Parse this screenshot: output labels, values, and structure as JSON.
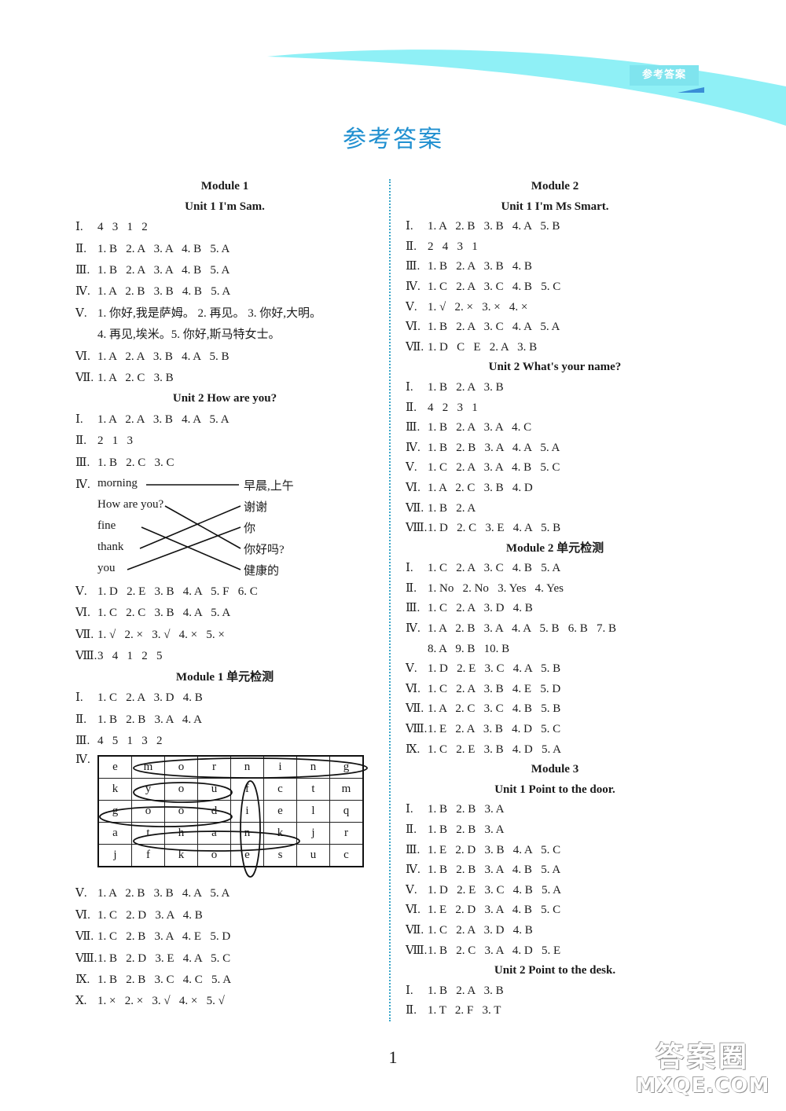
{
  "header": {
    "badge_label": "参考答案",
    "title": "参考答案",
    "brand_color": "#1f8fd0",
    "swoosh_color": "#8ff0f6"
  },
  "left_column": {
    "m1_title": "Module 1",
    "m1u1_title": "Unit 1   I'm Sam.",
    "m1u1": [
      {
        "n": "Ⅰ.",
        "a": "4   3   1   2"
      },
      {
        "n": "Ⅱ.",
        "a": "1. B   2. A   3. A   4. B   5. A"
      },
      {
        "n": "Ⅲ.",
        "a": "1. B   2. A   3. A   4. B   5. A"
      },
      {
        "n": "Ⅳ.",
        "a": "1. A   2. B   3. B   4. B   5. A"
      },
      {
        "n": "Ⅴ.",
        "a": "1. 你好,我是萨姆。 2. 再见。 3. 你好,大明。"
      },
      {
        "n": "",
        "a": "4. 再见,埃米。5. 你好,斯马特女士。"
      },
      {
        "n": "Ⅵ.",
        "a": "1. A   2. A   3. B   4. A   5. B"
      },
      {
        "n": "Ⅶ.",
        "a": "1. A   2. C   3. B"
      }
    ],
    "m1u2_title": "Unit 2   How are you?",
    "m1u2_top": [
      {
        "n": "Ⅰ.",
        "a": "1. A   2. A   3. B   4. A   5. A"
      },
      {
        "n": "Ⅱ.",
        "a": "2   1   3"
      },
      {
        "n": "Ⅲ.",
        "a": "1. B   2. C   3. C"
      }
    ],
    "matching": {
      "label": "Ⅳ.",
      "english": [
        "morning",
        "How are you?",
        "fine",
        "thank",
        "you"
      ],
      "chinese": [
        "早晨,上午",
        "谢谢",
        "你",
        "你好吗?",
        "健康的"
      ],
      "pairs": [
        [
          0,
          0
        ],
        [
          1,
          3
        ],
        [
          2,
          4
        ],
        [
          3,
          1
        ],
        [
          4,
          2
        ]
      ]
    },
    "m1u2_bottom": [
      {
        "n": "Ⅴ.",
        "a": "1. D   2. E   3. B   4. A   5. F   6. C"
      },
      {
        "n": "Ⅵ.",
        "a": "1. C   2. C   3. B   4. A   5. A"
      },
      {
        "n": "Ⅶ.",
        "a": "1. √   2. ×   3. √   4. ×   5. ×"
      },
      {
        "n": "Ⅷ.",
        "a": "3   4   1   2   5"
      }
    ],
    "m1test_title": "Module 1   单元检测",
    "m1test_top": [
      {
        "n": "Ⅰ.",
        "a": "1. C   2. A   3. D   4. B"
      },
      {
        "n": "Ⅱ.",
        "a": "1. B   2. B   3. A   4. A"
      },
      {
        "n": "Ⅲ.",
        "a": "4   5   1   3   2"
      }
    ],
    "word_search": {
      "label": "Ⅳ.",
      "grid": [
        [
          "e",
          "m",
          "o",
          "r",
          "n",
          "i",
          "n",
          "g"
        ],
        [
          "k",
          "y",
          "o",
          "u",
          "f",
          "c",
          "t",
          "m"
        ],
        [
          "g",
          "o",
          "o",
          "d",
          "i",
          "e",
          "l",
          "q"
        ],
        [
          "a",
          "t",
          "h",
          "a",
          "n",
          "k",
          "j",
          "r"
        ],
        [
          "j",
          "f",
          "k",
          "o",
          "e",
          "s",
          "u",
          "c"
        ]
      ],
      "found_words": [
        {
          "word": "morning",
          "row": 0,
          "col": 1,
          "dir": "h",
          "len": 7
        },
        {
          "word": "you",
          "row": 1,
          "col": 1,
          "dir": "h",
          "len": 3
        },
        {
          "word": "good",
          "row": 2,
          "col": 0,
          "dir": "h",
          "len": 4
        },
        {
          "word": "thank",
          "row": 3,
          "col": 1,
          "dir": "h",
          "len": 5
        },
        {
          "word": "fine",
          "row": 1,
          "col": 4,
          "dir": "v",
          "len": 4
        }
      ]
    },
    "m1test_bottom": [
      {
        "n": "Ⅴ.",
        "a": "1. A   2. B   3. B   4. A   5. A"
      },
      {
        "n": "Ⅵ.",
        "a": "1. C   2. D   3. A   4. B"
      },
      {
        "n": "Ⅶ.",
        "a": "1. C   2. B   3. A   4. E   5. D"
      },
      {
        "n": "Ⅷ.",
        "a": "1. B   2. D   3. E   4. A   5. C"
      },
      {
        "n": "Ⅸ.",
        "a": "1. B   2. B   3. C   4. C   5. A"
      },
      {
        "n": "Ⅹ.",
        "a": "1. ×   2. ×   3. √   4. ×   5. √"
      }
    ]
  },
  "right_column": {
    "m2_title": "Module 2",
    "m2u1_title": "Unit 1   I'm Ms Smart.",
    "m2u1": [
      {
        "n": "Ⅰ.",
        "a": "1. A   2. B   3. B   4. A   5. B"
      },
      {
        "n": "Ⅱ.",
        "a": "2   4   3   1"
      },
      {
        "n": "Ⅲ.",
        "a": "1. B   2. A   3. B   4. B"
      },
      {
        "n": "Ⅳ.",
        "a": "1. C   2. A   3. C   4. B   5. C"
      },
      {
        "n": "Ⅴ.",
        "a": "1. √   2. ×   3. ×   4. ×"
      },
      {
        "n": "Ⅵ.",
        "a": "1. B   2. A   3. C   4. A   5. A"
      },
      {
        "n": "Ⅶ.",
        "a": "1. D   C   E   2. A   3. B"
      }
    ],
    "m2u2_title": "Unit 2   What's your name?",
    "m2u2": [
      {
        "n": "Ⅰ.",
        "a": "1. B   2. A   3. B"
      },
      {
        "n": "Ⅱ.",
        "a": "4   2   3   1"
      },
      {
        "n": "Ⅲ.",
        "a": "1. B   2. A   3. A   4. C"
      },
      {
        "n": "Ⅳ.",
        "a": "1. B   2. B   3. A   4. A   5. A"
      },
      {
        "n": "Ⅴ.",
        "a": "1. C   2. A   3. A   4. B   5. C"
      },
      {
        "n": "Ⅵ.",
        "a": "1. A   2. C   3. B   4. D"
      },
      {
        "n": "Ⅶ.",
        "a": "1. B   2. A"
      },
      {
        "n": "Ⅷ.",
        "a": "1. D   2. C   3. E   4. A   5. B"
      }
    ],
    "m2test_title": "Module 2   单元检测",
    "m2test": [
      {
        "n": "Ⅰ.",
        "a": "1. C   2. A   3. C   4. B   5. A"
      },
      {
        "n": "Ⅱ.",
        "a": "1. No   2. No   3. Yes   4. Yes"
      },
      {
        "n": "Ⅲ.",
        "a": "1. C   2. A   3. D   4. B"
      },
      {
        "n": "Ⅳ.",
        "a": "1. A   2. B   3. A   4. A   5. B   6. B   7. B"
      },
      {
        "n": "",
        "a": "8. A   9. B   10. B"
      },
      {
        "n": "Ⅴ.",
        "a": "1. D   2. E   3. C   4. A   5. B"
      },
      {
        "n": "Ⅵ.",
        "a": "1. C   2. A   3. B   4. E   5. D"
      },
      {
        "n": "Ⅶ.",
        "a": "1. A   2. C   3. C   4. B   5. B"
      },
      {
        "n": "Ⅷ.",
        "a": "1. E   2. A   3. B   4. D   5. C"
      },
      {
        "n": "Ⅸ.",
        "a": "1. C   2. E   3. B   4. D   5. A"
      }
    ],
    "m3_title": "Module 3",
    "m3u1_title": "Unit 1   Point to the door.",
    "m3u1": [
      {
        "n": "Ⅰ.",
        "a": "1. B   2. B   3. A"
      },
      {
        "n": "Ⅱ.",
        "a": "1. B   2. B   3. A"
      },
      {
        "n": "Ⅲ.",
        "a": "1. E   2. D   3. B   4. A   5. C"
      },
      {
        "n": "Ⅳ.",
        "a": "1. B   2. B   3. A   4. B   5. A"
      },
      {
        "n": "Ⅴ.",
        "a": "1. D   2. E   3. C   4. B   5. A"
      },
      {
        "n": "Ⅵ.",
        "a": "1. E   2. D   3. A   4. B   5. C"
      },
      {
        "n": "Ⅶ.",
        "a": "1. C   2. A   3. D   4. B"
      },
      {
        "n": "Ⅷ.",
        "a": "1. B   2. C   3. A   4. D   5. E"
      }
    ],
    "m3u2_title": "Unit 2   Point to the desk.",
    "m3u2": [
      {
        "n": "Ⅰ.",
        "a": "1. B   2. A   3. B"
      },
      {
        "n": "Ⅱ.",
        "a": "1. T   2. F   3. T"
      }
    ]
  },
  "footer": {
    "page_number": "1",
    "watermark_top": "答案圈",
    "watermark_bottom": "MXQE.COM"
  }
}
